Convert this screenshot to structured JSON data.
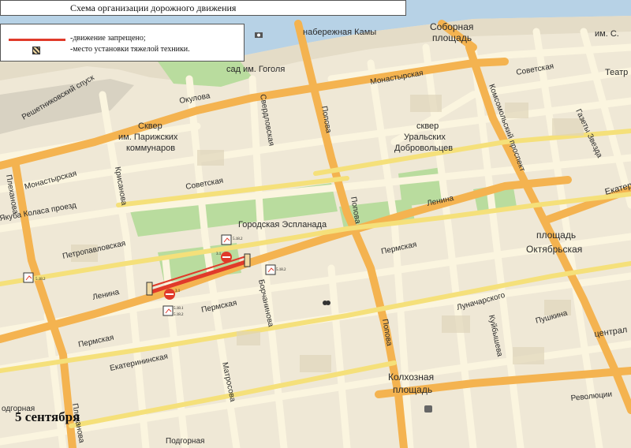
{
  "title": "Схема организации дорожного движения",
  "legend": {
    "closed_label": "-движение запрещено;",
    "equipment_label": "-место установки тяжелой техники."
  },
  "date": "5 сентября",
  "colors": {
    "closure": "#e03a2a",
    "major_road": "#f4b350",
    "minor_road": "#fbf5df",
    "park": "#b9dc9e",
    "water": "#b7d2e6",
    "block": "#e8dfc4"
  },
  "labels": {
    "naberezhnaya": "набережная Камы",
    "sobornaya_1": "Соборная",
    "sobornaya_2": "площадь",
    "im_s": "им. С.",
    "sad_gogolya": "сад им. Гоголя",
    "monastyrskaya_n": "Монастырская",
    "sovetskaya_ne": "Советская",
    "teatr": "Театр",
    "reshetnikovsky": "Решетниковский спуск",
    "okulova": "Окулова",
    "skver_pk_1": "Сквер",
    "skver_pk_2": "им. Парижских",
    "skver_pk_3": "коммунаров",
    "sverdlovskaya": "Свердловская",
    "popova_top": "Попова",
    "skver_ud_1": "сквер",
    "skver_ud_2": "Уральских",
    "skver_ud_3": "Добровольцев",
    "komsomolsky": "Комсомольский проспект",
    "gazety_zvezda": "Газеты Звезда",
    "monastyrskaya_w": "Монастырская",
    "sovetskaya_c": "Советская",
    "plekhanova": "Плеханова",
    "krisanova": "Крисанова",
    "yakuba_kolasa": "Якуба Коласа проезд",
    "gorodskaya_esplanada": "Городская Эспланада",
    "lenina_e": "Ленина",
    "ekater_e": "Екатер",
    "popova_mid": "Попова",
    "petropavlovskaya": "Петропавловская",
    "ploshchad_okt_1": "площадь",
    "ploshchad_okt_2": "Октябрьская",
    "permskaya_c": "Пермская",
    "lenina_w": "Ленина",
    "permskaya_mid": "Пермская",
    "borchaninova": "Борчанинова",
    "lunacharskogo": "Луначарского",
    "kuybysheva": "Куйбышева",
    "pushkina": "Пушкина",
    "tsentral": "централ",
    "permskaya_w": "Пермская",
    "popova_s": "Попова",
    "ekaterininskaya": "Екатерининская",
    "matrosova": "Матросова",
    "kolkhoznaya_1": "Колхозная",
    "kolkhoznaya_2": "площадь",
    "revolyutsii": "Революции",
    "podgornaya_w": "одгорная",
    "plekhanova_s": "Плеханова",
    "podgornaya_s": "Подгорная"
  },
  "signs": {
    "s1": "3.1",
    "s2": "3.1",
    "sign_tag_1": "5.18.2",
    "sign_tag_2": "5.18.2",
    "sign_tag_3": "5.18.1",
    "sign_tag_4": "5.18.2",
    "sign_tag_5": "5.18.2"
  }
}
